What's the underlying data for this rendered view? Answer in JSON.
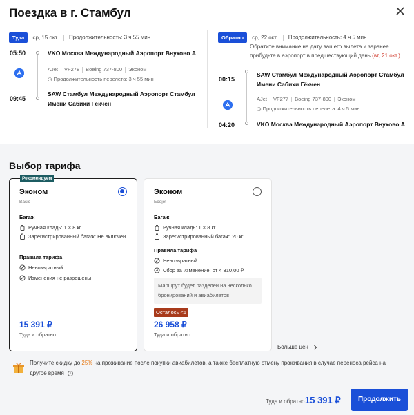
{
  "title": "Поездка в г. Стамбул",
  "outbound": {
    "badge": "Туда",
    "date": "ср, 15 окт.",
    "duration": "Продолжительность: 3 ч 55 мин",
    "dep_time": "05:50",
    "dep_airport": "VKO Москва Международный Аэропорт Внуково А",
    "airline": "AJet",
    "flight": "VF278",
    "aircraft": "Boeing 737-800",
    "cabin": "Эконом",
    "flight_duration": "Продолжительность перелета: 3 ч 55 мин",
    "arr_time": "09:45",
    "arr_airport_line1": "SAW Стамбул Международный Аэропорт Стамбул",
    "arr_airport_line2": "Имени Сабихи Гёкчен"
  },
  "return": {
    "badge": "Обратно",
    "date": "ср, 22 окт.",
    "duration": "Продолжительность: 4 ч 5 мин",
    "notice_line1": "Обратите внимание на дату вашего вылета и заранее",
    "notice_line2_prefix": "прибудьте в аэропорт в предшествующий день",
    "notice_line2_red": "(вт, 21 окт.)",
    "dep_time": "00:15",
    "dep_airport_line1": "SAW Стамбул Международный Аэропорт Стамбул",
    "dep_airport_line2": "Имени Сабихи Гёкчен",
    "airline": "AJet",
    "flight": "VF277",
    "aircraft": "Boeing 737-800",
    "cabin": "Эконом",
    "flight_duration": "Продолжительность перелета: 4 ч 5 мин",
    "arr_time": "04:20",
    "arr_airport": "VKO Москва Международный Аэропорт Внуково А"
  },
  "tariff_section_title": "Выбор тарифа",
  "cards": [
    {
      "recommended": "Рекомендуем",
      "name": "Эконом",
      "sub": "Basic",
      "baggage_title": "Багаж",
      "hand": "Ручная кладь: 1 × 8 кг",
      "checked": "Зарегистрированный багаж: Не включен",
      "rules_title": "Правила тарифа",
      "rule1": "Невозвратный",
      "rule2": "Изменения не разрешены",
      "price": "15 391 ₽",
      "price_sub": "Туда и обратно"
    },
    {
      "name": "Эконом",
      "sub": "Ecojet",
      "baggage_title": "Багаж",
      "hand": "Ручная кладь: 1 × 8 кг",
      "checked": "Зарегистрированный багаж: 20 кг",
      "rules_title": "Правила тарифа",
      "rule1": "Невозвратный",
      "rule2": "Сбор за изменение: от 4 310,00 ₽",
      "note": "Маршрут будет разделен на несколько бронирований и авиабилетов",
      "left": "Осталось <5",
      "price": "26 958 ₽",
      "price_sub": "Туда и обратно"
    }
  ],
  "more_prices": "Больше цен",
  "promo": {
    "prefix": "Получите скидку до",
    "percent": "25%",
    "suffix": "на проживание после покупки авиабилетов, а также бесплатную отмену проживания в случае переноса рейса на другое время",
    "info": "i"
  },
  "footer": {
    "label": "Туда и обратно",
    "price": "15 391 ₽",
    "button": "Продолжить"
  },
  "colors": {
    "accent": "#1a4fd8",
    "recommend": "#1c5c62",
    "urgent": "#a83a1b",
    "promo_orange": "#e67a17"
  }
}
